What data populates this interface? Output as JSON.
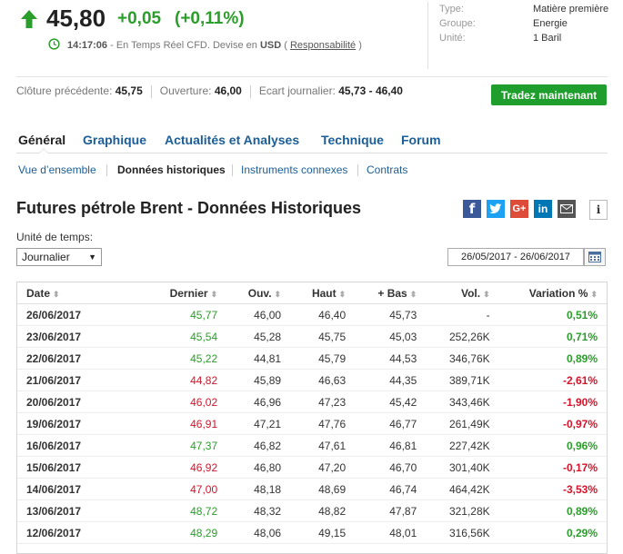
{
  "quote": {
    "price": "45,80",
    "change": "+0,05",
    "change_pct": "(+0,11%)",
    "time": "14:17:06",
    "timeline_text": " - En Temps Réel CFD. Devise en ",
    "currency": "USD",
    "paren_open": " ( ",
    "disclaimer_link": "Responsabilité",
    "paren_close": " )",
    "up_color": "#2a9d2a",
    "down_color": "#d3142b"
  },
  "meta": [
    {
      "label": "Type:",
      "value": "Matière première"
    },
    {
      "label": "Groupe:",
      "value": "Energie"
    },
    {
      "label": "Unité:",
      "value": "1 Baril"
    }
  ],
  "stats": {
    "prev_close_label": "Clôture précédente:",
    "prev_close": "45,75",
    "open_label": "Ouverture:",
    "open": "46,00",
    "range_label": "Ecart journalier:",
    "range": "45,73 - 46,40"
  },
  "trade_button": "Tradez maintenant",
  "tabs": [
    "Général",
    "Graphique",
    "Actualités et Analyses",
    "Technique",
    "Forum"
  ],
  "subtabs": [
    "Vue d’ensemble",
    "Données historiques",
    "Instruments connexes",
    "Contrats"
  ],
  "page_title": "Futures pétrole Brent - Données Historiques",
  "share_icons": [
    "facebook-icon",
    "twitter-icon",
    "google-plus-icon",
    "linkedin-icon",
    "email-icon",
    "info-icon"
  ],
  "time_unit_label": "Unité de temps:",
  "time_unit_value": "Journalier",
  "date_range": "26/05/2017 - 26/06/2017",
  "table": {
    "headers": [
      "Date",
      "Dernier",
      "Ouv.",
      "Haut",
      "+ Bas",
      "Vol.",
      "Variation %"
    ],
    "rows": [
      {
        "date": "26/06/2017",
        "last": "45,77",
        "open": "46,00",
        "high": "46,40",
        "low": "45,73",
        "vol": "-",
        "chg": "0,51%",
        "dir": "up"
      },
      {
        "date": "23/06/2017",
        "last": "45,54",
        "open": "45,28",
        "high": "45,75",
        "low": "45,03",
        "vol": "252,26K",
        "chg": "0,71%",
        "dir": "up"
      },
      {
        "date": "22/06/2017",
        "last": "45,22",
        "open": "44,81",
        "high": "45,79",
        "low": "44,53",
        "vol": "346,76K",
        "chg": "0,89%",
        "dir": "up"
      },
      {
        "date": "21/06/2017",
        "last": "44,82",
        "open": "45,89",
        "high": "46,63",
        "low": "44,35",
        "vol": "389,71K",
        "chg": "-2,61%",
        "dir": "down"
      },
      {
        "date": "20/06/2017",
        "last": "46,02",
        "open": "46,96",
        "high": "47,23",
        "low": "45,42",
        "vol": "343,46K",
        "chg": "-1,90%",
        "dir": "down"
      },
      {
        "date": "19/06/2017",
        "last": "46,91",
        "open": "47,21",
        "high": "47,76",
        "low": "46,77",
        "vol": "261,49K",
        "chg": "-0,97%",
        "dir": "down"
      },
      {
        "date": "16/06/2017",
        "last": "47,37",
        "open": "46,82",
        "high": "47,61",
        "low": "46,81",
        "vol": "227,42K",
        "chg": "0,96%",
        "dir": "up"
      },
      {
        "date": "15/06/2017",
        "last": "46,92",
        "open": "46,80",
        "high": "47,20",
        "low": "46,70",
        "vol": "301,40K",
        "chg": "-0,17%",
        "dir": "down"
      },
      {
        "date": "14/06/2017",
        "last": "47,00",
        "open": "48,18",
        "high": "48,69",
        "low": "46,74",
        "vol": "464,42K",
        "chg": "-3,53%",
        "dir": "down"
      },
      {
        "date": "13/06/2017",
        "last": "48,72",
        "open": "48,32",
        "high": "48,82",
        "low": "47,87",
        "vol": "321,28K",
        "chg": "0,89%",
        "dir": "up"
      },
      {
        "date": "12/06/2017",
        "last": "48,29",
        "open": "48,06",
        "high": "49,15",
        "low": "48,01",
        "vol": "316,56K",
        "chg": "0,29%",
        "dir": "up"
      }
    ]
  }
}
